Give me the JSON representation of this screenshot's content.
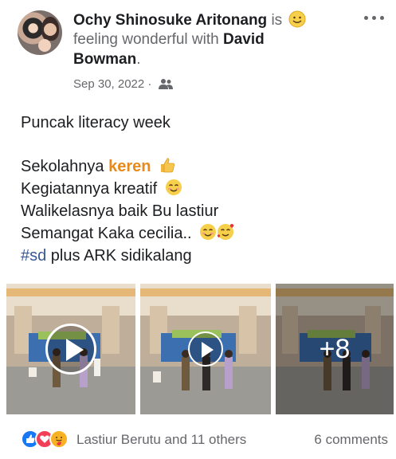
{
  "post": {
    "author": "Ochy Shinosuke Aritonang",
    "is_text": "is",
    "feeling": "feeling wonderful with",
    "tagged": "David",
    "tagged_last": "Bowman",
    "period": ".",
    "date": "Sep 30, 2022",
    "separator": "·",
    "audience_icon": "friends-icon",
    "more_icon": "more-options-icon"
  },
  "content": {
    "line1": "Puncak literacy week",
    "line2_prefix": "Sekolahnya",
    "line2_highlight": "keren",
    "line3": "Kegiatannya kreatif",
    "line4": "Walikelasnya baik Bu lastiur",
    "line5": "Semangat Kaka cecilia..",
    "hashtag": "#sd",
    "line6_rest": " plus ARK sidikalang"
  },
  "media": {
    "more_count": "+8",
    "items": [
      {
        "type": "video"
      },
      {
        "type": "video"
      },
      {
        "type": "video"
      }
    ]
  },
  "footer": {
    "reactions": [
      "like",
      "love",
      "care"
    ],
    "reactor_text": "Lastiur Berutu and 11 others",
    "comments": "6 comments"
  },
  "colors": {
    "accent": "#1877f2",
    "muted": "#65676b",
    "highlight": "#e88a1a",
    "hashtag": "#385898"
  }
}
